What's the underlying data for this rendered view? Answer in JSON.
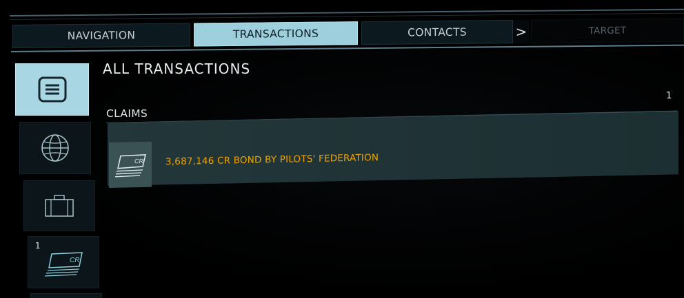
{
  "tabs": [
    {
      "label": "NAVIGATION"
    },
    {
      "label": "TRANSACTIONS",
      "active": true
    },
    {
      "label": "CONTACTS"
    },
    {
      "label": "TARGET"
    }
  ],
  "tab_arrow": ">",
  "sidebar": {
    "items": [
      {
        "icon": "list-icon",
        "active": true
      },
      {
        "icon": "globe-icon"
      },
      {
        "icon": "briefcase-icon"
      },
      {
        "icon": "credit-note-icon",
        "count": "1"
      }
    ]
  },
  "main": {
    "title": "ALL TRANSACTIONS",
    "count": "1",
    "section": {
      "title": "CLAIMS",
      "items": [
        {
          "icon": "credit-note-icon",
          "text": "3,687,146 CR BOND BY PILOTS' FEDERATION"
        }
      ]
    }
  },
  "colors": {
    "accent": "#9ecfdd",
    "claim_text": "#f0a400",
    "row_bg": "#23373a"
  }
}
